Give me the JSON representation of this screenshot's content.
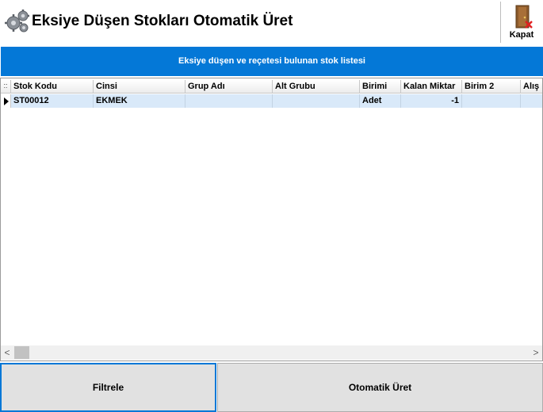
{
  "window": {
    "title": "Eksiye Düşen Stokları Otomatik Üret",
    "close_label": "Kapat"
  },
  "header": {
    "caption": "Eksiye düşen ve reçetesi bulunan stok listesi"
  },
  "grid": {
    "indicator_header": "::",
    "columns": [
      "Stok Kodu",
      "Cinsi",
      "Grup Adı",
      "Alt Grubu",
      "Birimi",
      "Kalan Miktar",
      "Birim 2",
      "Alış F"
    ],
    "rows": [
      {
        "stok_kodu": "ST00012",
        "cinsi": "EKMEK",
        "grup_adi": "",
        "alt_grubu": "",
        "birimi": "Adet",
        "kalan_miktar": "-1",
        "birim2": "",
        "alis": ""
      }
    ],
    "selection_color": "#d9e9f9",
    "scroll_left": "<",
    "scroll_right": ">"
  },
  "buttons": {
    "filter_label": "Filtrele",
    "auto_produce_label": "Otomatik Üret"
  },
  "colors": {
    "accent": "#0478d7",
    "focus_border": "#0078d7"
  },
  "icons": {
    "app": "gears-icon",
    "close": "door-exit-icon"
  }
}
